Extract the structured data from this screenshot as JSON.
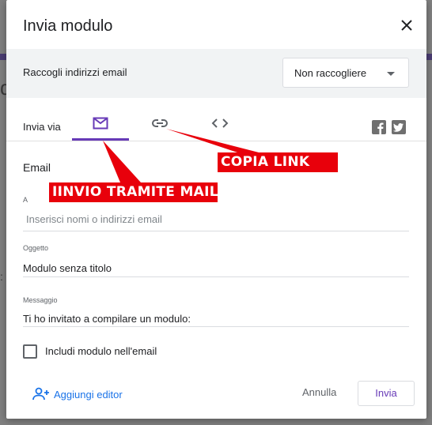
{
  "dialog": {
    "title": "Invia modulo"
  },
  "collect": {
    "label": "Raccogli indirizzi email",
    "selected": "Non raccogliere"
  },
  "send_via": {
    "label": "Invia via",
    "tabs": [
      {
        "name": "email",
        "icon": "mail-icon",
        "active": true
      },
      {
        "name": "link",
        "icon": "link-icon",
        "active": false
      },
      {
        "name": "embed",
        "icon": "code-icon",
        "active": false
      }
    ],
    "social": [
      "facebook-icon",
      "twitter-icon"
    ]
  },
  "email": {
    "section_title": "Email",
    "to_label": "A",
    "to_placeholder": "Inserisci nomi o indirizzi email",
    "subject_label": "Oggetto",
    "subject_value": "Modulo senza titolo",
    "message_label": "Messaggio",
    "message_value": "Ti ho invitato a compilare un modulo:",
    "include_form_label": "Includi modulo nell'email",
    "include_form_checked": false
  },
  "footer": {
    "add_editor": "Aggiungi editor",
    "cancel": "Annulla",
    "send": "Invia"
  },
  "annotations": {
    "link_callout": "COPIA LINK",
    "mail_callout": "IINVIO TRAMITE MAIL"
  },
  "colors": {
    "accent": "#673ab7",
    "link_blue": "#1a73e8",
    "annotation_red": "#e8000b"
  }
}
